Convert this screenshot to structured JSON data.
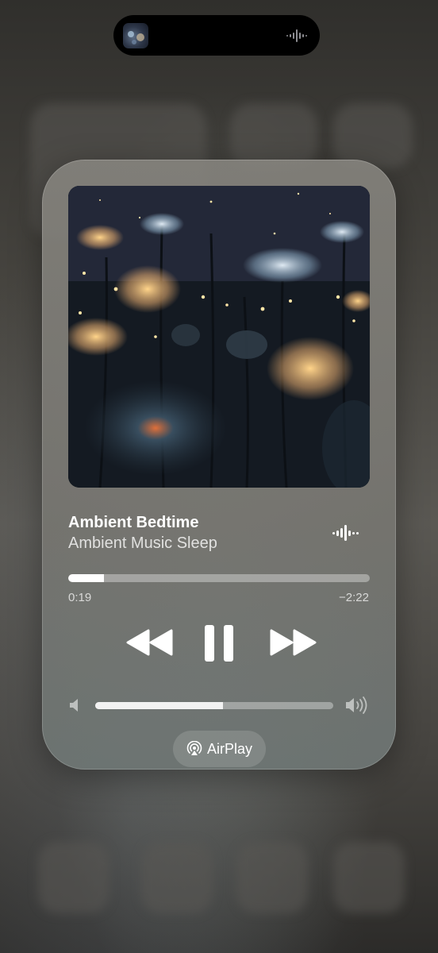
{
  "now_playing": {
    "title": "Ambient Bedtime",
    "artist": "Ambient Music Sleep",
    "elapsed": "0:19",
    "remaining": "−2:22",
    "progress_fraction": 0.118,
    "volume_fraction": 0.535
  },
  "controls": {
    "rewind_icon": "backward-icon",
    "pause_icon": "pause-icon",
    "forward_icon": "forward-icon",
    "waveform_icon": "waveform-icon",
    "volume_low_icon": "speaker-low-icon",
    "volume_high_icon": "speaker-high-icon"
  },
  "airplay": {
    "label": "AirPlay",
    "icon": "airplay-icon"
  },
  "dynamic_island": {
    "artwork_icon": "album-thumbnail",
    "activity_icon": "waveform-icon"
  },
  "colors": {
    "card": "#807e79",
    "accent": "#ffffff",
    "track": "#b7b6b2"
  }
}
